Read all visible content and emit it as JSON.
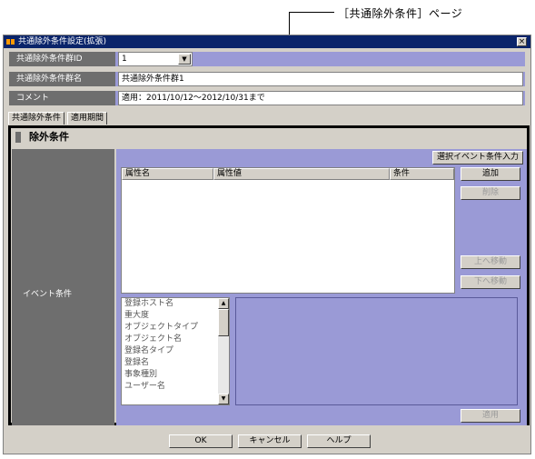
{
  "callout": {
    "text": "［共通除外条件］ページ"
  },
  "window": {
    "title": "共通除外条件設定(拡張)",
    "close": "×"
  },
  "form": {
    "group_id": {
      "label": "共通除外条件群ID",
      "value": "1"
    },
    "group_name": {
      "label": "共通除外条件群名",
      "value": "共通除外条件群1"
    },
    "comment": {
      "label": "コメント",
      "value": "適用：2011/10/12～2012/10/31まで"
    }
  },
  "tabs": [
    {
      "label": "共通除外条件"
    },
    {
      "label": "適用期間"
    }
  ],
  "panel": {
    "title": "除外条件",
    "side_label": "イベント条件",
    "select_event_button": "選択イベント条件入力",
    "table_headers": [
      "属性名",
      "属性値",
      "条件"
    ],
    "buttons": {
      "add": "追加",
      "delete": "削除",
      "move_up": "上へ移動",
      "move_down": "下へ移動",
      "apply": "適用"
    },
    "attributes": [
      "登録ホスト名",
      "重大度",
      "オブジェクトタイプ",
      "オブジェクト名",
      "登録名タイプ",
      "登録名",
      "事象種別",
      "ユーザー名"
    ]
  },
  "footer": {
    "ok": "OK",
    "cancel": "キャンセル",
    "help": "ヘルプ"
  },
  "icons": {
    "select_arrow": "▼",
    "scroll_up": "▲",
    "scroll_down": "▼"
  }
}
